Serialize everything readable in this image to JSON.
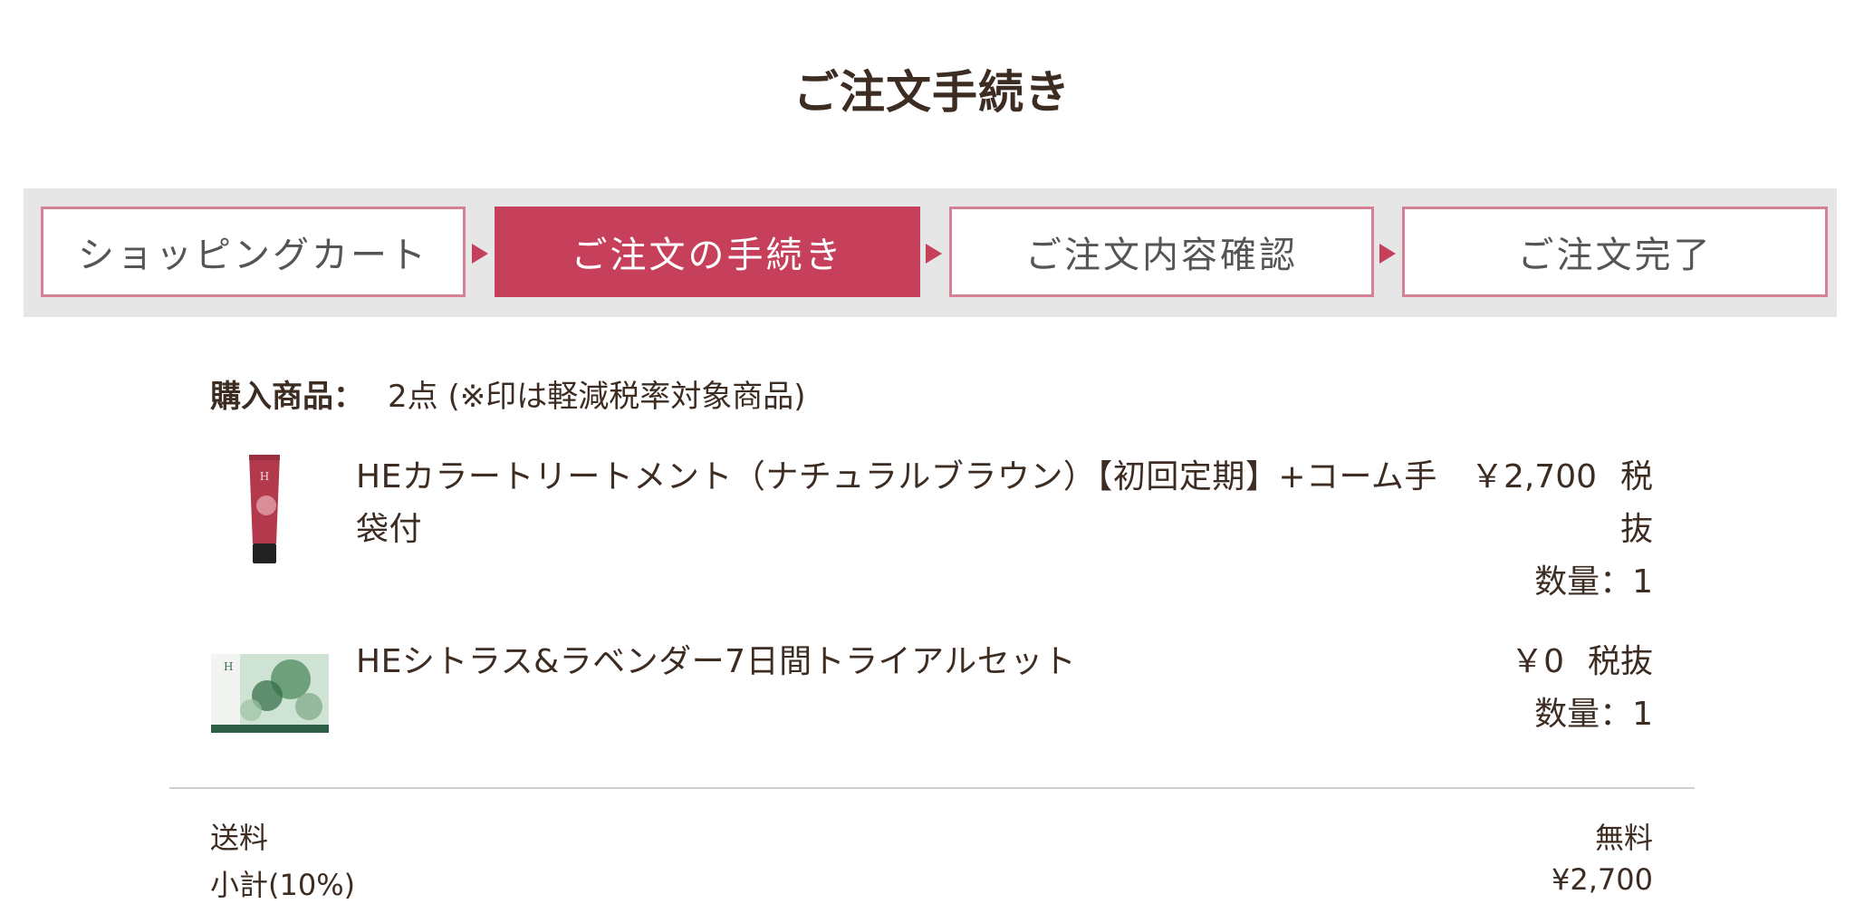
{
  "page": {
    "title": "ご注文手続き"
  },
  "steps": [
    {
      "label": "ショッピングカート",
      "active": false
    },
    {
      "label": "ご注文の手続き",
      "active": true
    },
    {
      "label": "ご注文内容確認",
      "active": false
    },
    {
      "label": "ご注文完了",
      "active": false
    }
  ],
  "summary": {
    "label": "購入商品：",
    "value": "2点 (※印は軽減税率対象商品)"
  },
  "items": [
    {
      "name": "HEカラートリートメント（ナチュラルブラウン）【初回定期】+コーム手袋付",
      "price": "￥2,700",
      "tax_label": "税抜",
      "quantity": "数量：1",
      "image_icon": "treatment-tube-image"
    },
    {
      "name": "HEシトラス&ラベンダー7日間トライアルセット",
      "price": "￥0",
      "tax_label": "税抜",
      "quantity": "数量：1",
      "image_icon": "trial-set-image"
    }
  ],
  "totals": [
    {
      "label": "送料",
      "value": "無料"
    },
    {
      "label": "小計(10%)",
      "value": "¥2,700"
    }
  ],
  "colors": {
    "accent": "#c6405b",
    "step_border": "#d58094",
    "text": "#3d2c22",
    "bar_bg": "#e6e6e6"
  }
}
